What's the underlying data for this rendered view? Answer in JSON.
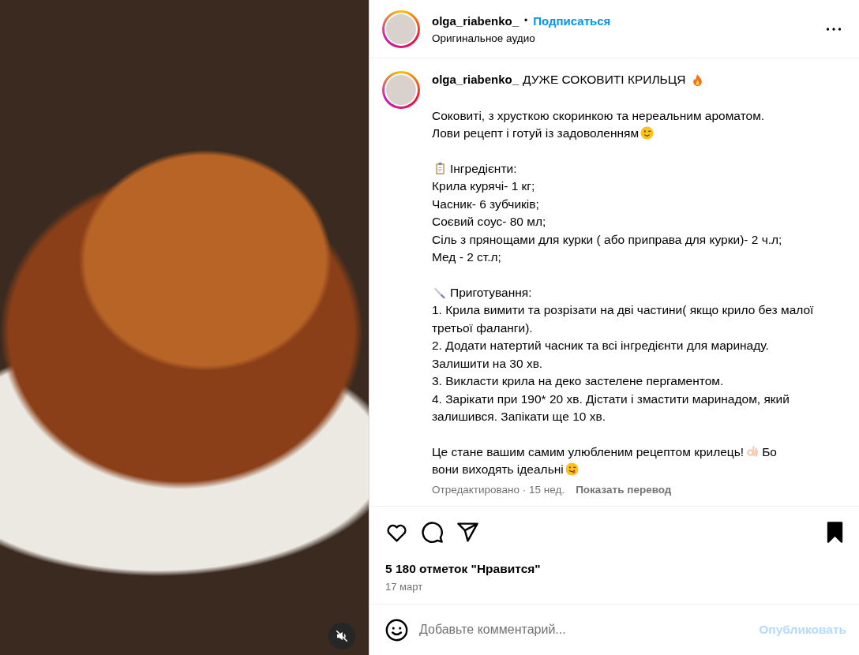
{
  "media": {
    "muted": true
  },
  "header": {
    "username": "olga_riabenko_",
    "separator": "•",
    "follow": "Подписаться",
    "audio": "Оригинальное аудио"
  },
  "caption": {
    "username": "olga_riabenko_",
    "title": [
      {
        "kind": "text",
        "text": "ДУЖЕ СОКОВИТІ КРИЛЬЦЯ"
      },
      {
        "kind": "fire"
      }
    ],
    "paragraphs": [
      {
        "lines": [
          [
            {
              "kind": "text",
              "text": "Соковиті, з хрусткою скоринкою та нереальним ароматом."
            }
          ],
          [
            {
              "kind": "text",
              "text": "Лови рецепт і готуй із задоволенням"
            },
            {
              "kind": "wink"
            }
          ]
        ]
      },
      {
        "lines": [
          [
            {
              "kind": "clipboard"
            },
            {
              "kind": "text",
              "text": "Інгредієнти:"
            }
          ],
          [
            {
              "kind": "text",
              "text": "Крила курячі- 1 кг;"
            }
          ],
          [
            {
              "kind": "text",
              "text": "Часник- 6 зубчиків;"
            }
          ],
          [
            {
              "kind": "text",
              "text": "Соєвий соус- 80 мл;"
            }
          ],
          [
            {
              "kind": "text",
              "text": "Сіль з прянощами для курки ( або приправа для курки)- 2 ч.л;"
            }
          ],
          [
            {
              "kind": "text",
              "text": "Мед - 2 ст.л;"
            }
          ]
        ]
      },
      {
        "lines": [
          [
            {
              "kind": "knife"
            },
            {
              "kind": "text",
              "text": "Приготування:"
            }
          ],
          [
            {
              "kind": "text",
              "text": "1. Крила вимити та розрізати на дві частини( якщо крило без малої третьої фаланги)."
            }
          ],
          [
            {
              "kind": "text",
              "text": "2. Додати натертий часник та всі інгредієнти для маринаду. Залишити на 30 хв."
            }
          ],
          [
            {
              "kind": "text",
              "text": "3. Викласти крила на деко застелене пергаментом."
            }
          ],
          [
            {
              "kind": "text",
              "text": "4. Зарікати при 190* 20 хв. Дістати і змастити маринадом, який залишився. Запікати ще 10 хв."
            }
          ]
        ]
      },
      {
        "lines": [
          [
            {
              "kind": "text",
              "text": "Це стане вашим самим улюбленим рецептом крилець!"
            },
            {
              "kind": "ok_hand"
            },
            {
              "kind": "text",
              "text": "Бо"
            }
          ],
          [
            {
              "kind": "text",
              "text": "вони виходять ідеальні"
            },
            {
              "kind": "yum"
            }
          ]
        ]
      }
    ],
    "edited": "Отредактировано · 15 нед.",
    "translate": "Показать перевод"
  },
  "actions": {
    "liked": false,
    "saved": true
  },
  "likes": "5 180 отметок \"Нравится\"",
  "date": "17 март",
  "comment": {
    "placeholder": "Добавьте комментарий...",
    "publish": "Опубликовать",
    "publish_disabled": true
  }
}
